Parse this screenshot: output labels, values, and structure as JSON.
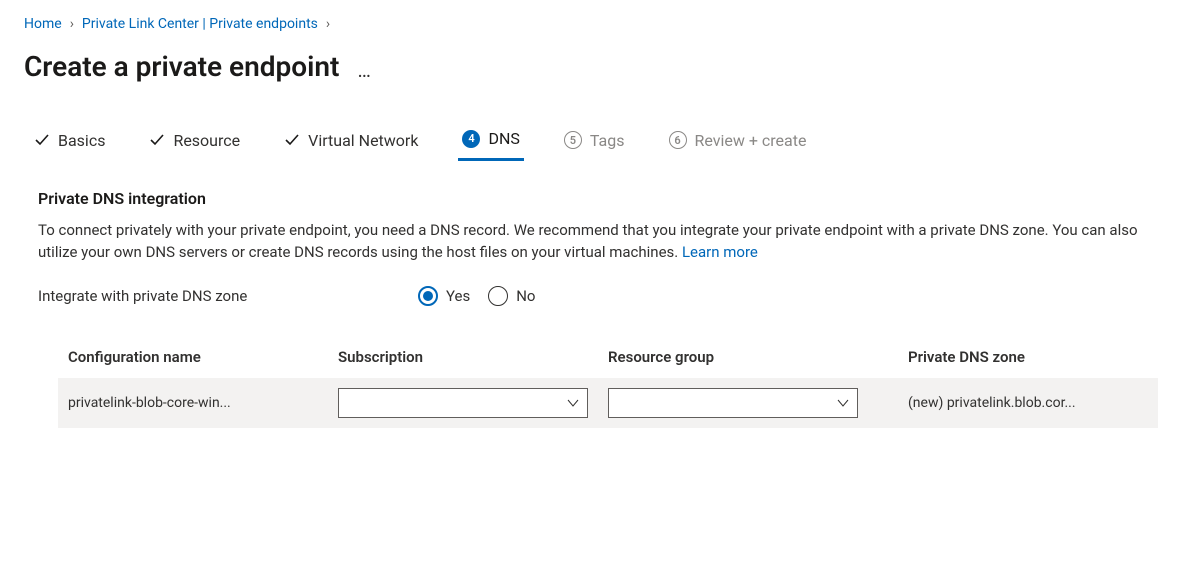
{
  "breadcrumb": {
    "home": "Home",
    "mid": "Private Link Center | Private endpoints"
  },
  "title": "Create a private endpoint",
  "tabs": {
    "basics": "Basics",
    "resource": "Resource",
    "vnet": "Virtual Network",
    "dns_num": "4",
    "dns": "DNS",
    "tags_num": "5",
    "tags": "Tags",
    "review_num": "6",
    "review": "Review + create"
  },
  "section": {
    "heading": "Private DNS integration",
    "desc": "To connect privately with your private endpoint, you need a DNS record. We recommend that you integrate your private endpoint with a private DNS zone. You can also utilize your own DNS servers or create DNS records using the host files on your virtual machines.  ",
    "learn_more": "Learn more"
  },
  "field": {
    "label": "Integrate with private DNS zone",
    "yes": "Yes",
    "no": "No"
  },
  "table": {
    "h1": "Configuration name",
    "h2": "Subscription",
    "h3": "Resource group",
    "h4": "Private DNS zone",
    "r1c1": "privatelink-blob-core-win...",
    "r1c4": "(new) privatelink.blob.cor..."
  }
}
